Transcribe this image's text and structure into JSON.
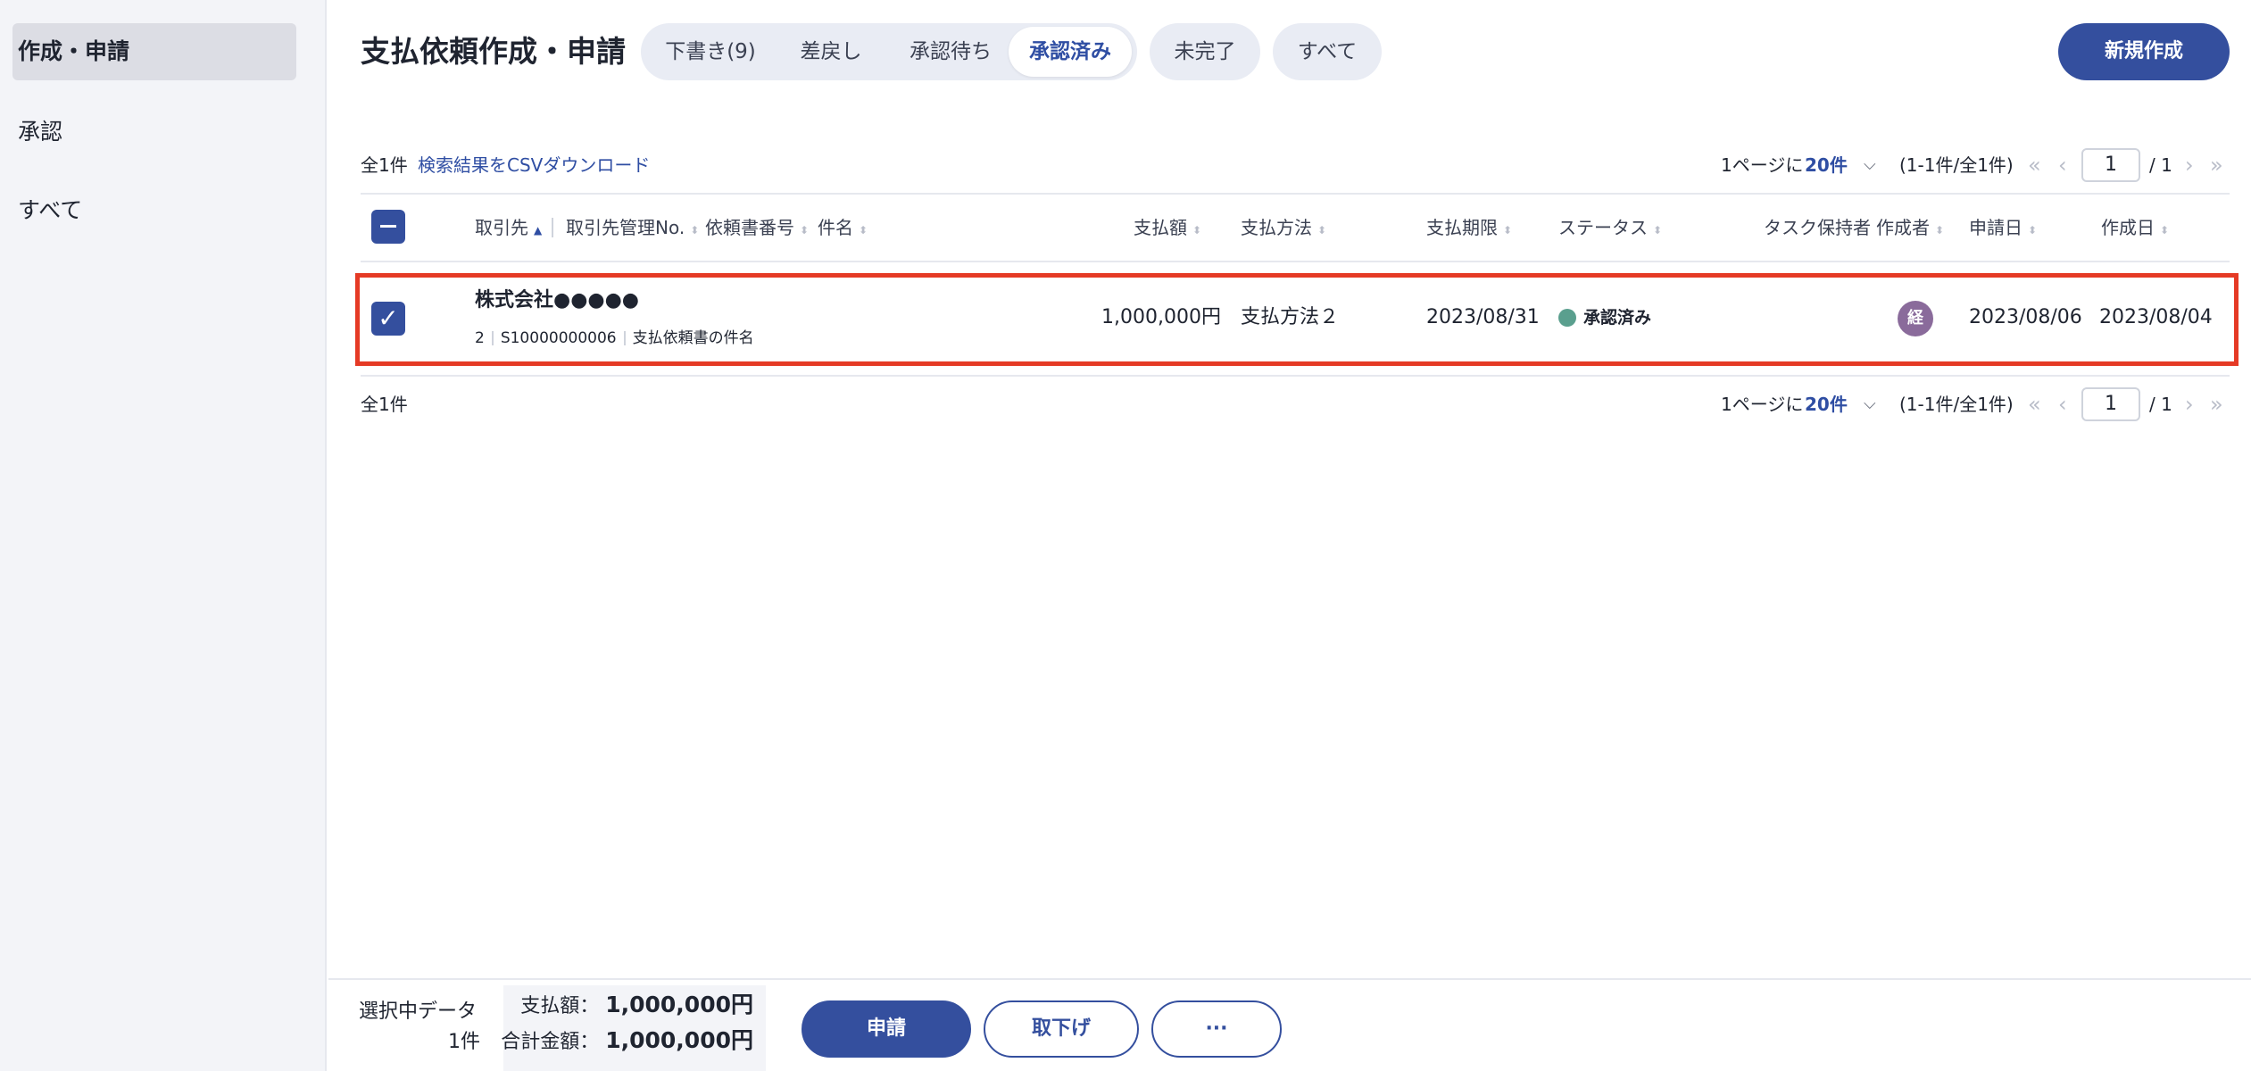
{
  "sidebar": {
    "items": [
      {
        "label": "作成・申請"
      },
      {
        "label": "承認"
      },
      {
        "label": "すべて"
      }
    ]
  },
  "header": {
    "title": "支払依頼作成・申請",
    "tabs": [
      {
        "label": "下書き(9)"
      },
      {
        "label": "差戻し"
      },
      {
        "label": "承認待ち"
      },
      {
        "label": "承認済み"
      }
    ],
    "pills": [
      {
        "label": "未完了"
      },
      {
        "label": "すべて"
      }
    ],
    "new_button": "新規作成"
  },
  "toolbar": {
    "count": "全1件",
    "csv_link": "検索結果をCSVダウンロード",
    "per_page_prefix": "1ページに",
    "per_page_value": "20件",
    "range": "(1-1件/全1件)",
    "page_current": "1",
    "page_total": "/ 1"
  },
  "table": {
    "columns": [
      {
        "label": "取引先"
      },
      {
        "label": "取引先管理No."
      },
      {
        "label": "依頼書番号"
      },
      {
        "label": "件名"
      },
      {
        "label": "支払額"
      },
      {
        "label": "支払方法"
      },
      {
        "label": "支払期限"
      },
      {
        "label": "ステータス"
      },
      {
        "label": "タスク保持者"
      },
      {
        "label": "作成者"
      },
      {
        "label": "申請日"
      },
      {
        "label": "作成日"
      }
    ],
    "rows": [
      {
        "vendor": "株式会社●●●●●",
        "vendor_no": "2",
        "request_no": "S10000000006",
        "subject": "支払依頼書の件名",
        "amount": "1,000,000円",
        "method": "支払方法２",
        "due": "2023/08/31",
        "status": "承認済み",
        "creator_initial": "経",
        "applied": "2023/08/06",
        "created": "2023/08/04"
      }
    ]
  },
  "footer_pager": {
    "count": "全1件"
  },
  "footer": {
    "selected_label": "選択中データ",
    "selected_count": "1件",
    "amount_label": "支払額：",
    "amount_value": "1,000,000円",
    "total_label": "合計金額：",
    "total_value": "1,000,000円",
    "apply_button": "申請",
    "withdraw_button": "取下げ",
    "more_button": "···"
  },
  "colors": {
    "primary": "#344f9e",
    "highlight": "#e53a25",
    "status_approved": "#5a9f8e",
    "avatar": "#8a6b9b"
  }
}
